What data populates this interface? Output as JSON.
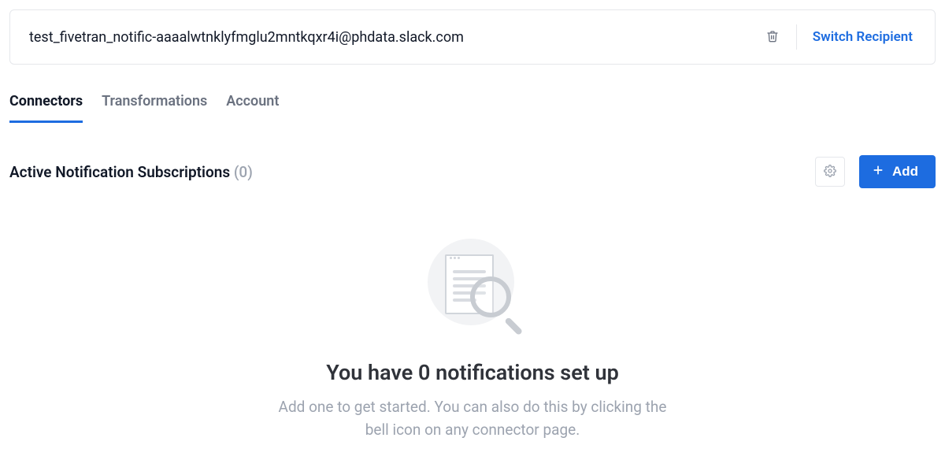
{
  "recipient": {
    "email": "test_fivetran_notific-aaaalwtnklyfmglu2mntkqxr4i@phdata.slack.com",
    "switch_label": "Switch Recipient"
  },
  "tabs": {
    "connectors": "Connectors",
    "transformations": "Transformations",
    "account": "Account"
  },
  "section": {
    "title": "Active Notification Subscriptions",
    "count": "(0)",
    "add_label": "Add"
  },
  "empty": {
    "heading": "You have 0 notifications set up",
    "sub": "Add one to get started. You can also do this by clicking the bell icon on any connector page."
  }
}
